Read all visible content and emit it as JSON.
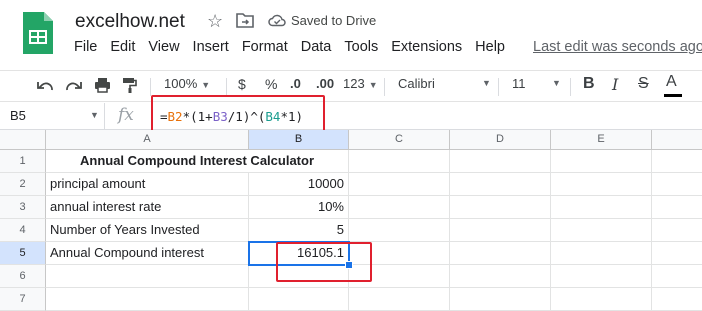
{
  "header": {
    "doc_title": "excelhow.net",
    "save_status": "Saved to Drive",
    "last_edit": "Last edit was seconds ago",
    "menu": [
      "File",
      "Edit",
      "View",
      "Insert",
      "Format",
      "Data",
      "Tools",
      "Extensions",
      "Help"
    ]
  },
  "toolbar": {
    "zoom": "100%",
    "currency": "$",
    "percent": "%",
    "decrease_decimal": ".0",
    "increase_decimal": ".00",
    "more_formats": "123",
    "font": "Calibri",
    "font_size": "11",
    "bold": "B",
    "italic": "I",
    "strikethrough": "S",
    "text_color": "A"
  },
  "formula_bar": {
    "name_box": "B5",
    "fx": "fx",
    "formula_parts": [
      {
        "text": "=",
        "color": "#202124"
      },
      {
        "text": "B2",
        "color": "#e8710a"
      },
      {
        "text": "*(1+",
        "color": "#202124"
      },
      {
        "text": "B3",
        "color": "#7b61c8"
      },
      {
        "text": "/1)^(",
        "color": "#202124"
      },
      {
        "text": "B4",
        "color": "#1a9d8f"
      },
      {
        "text": "*1)",
        "color": "#202124"
      }
    ]
  },
  "grid": {
    "columns": [
      "A",
      "B",
      "C",
      "D",
      "E"
    ],
    "rows": [
      "1",
      "2",
      "3",
      "4",
      "5",
      "6",
      "7"
    ],
    "title": "Annual Compound Interest Calculator",
    "a_labels": [
      "principal amount",
      "annual interest rate",
      "Number of Years Invested",
      "Annual Compound interest"
    ],
    "b_values": [
      "10000",
      "10%",
      "5",
      "16105.1"
    ],
    "selected_cell": "B5"
  },
  "colors": {
    "accent": "#1a73e8",
    "highlight_box": "#e0202e",
    "header_bg": "#f8f9fa",
    "selected_header_bg": "#d3e3fd"
  }
}
